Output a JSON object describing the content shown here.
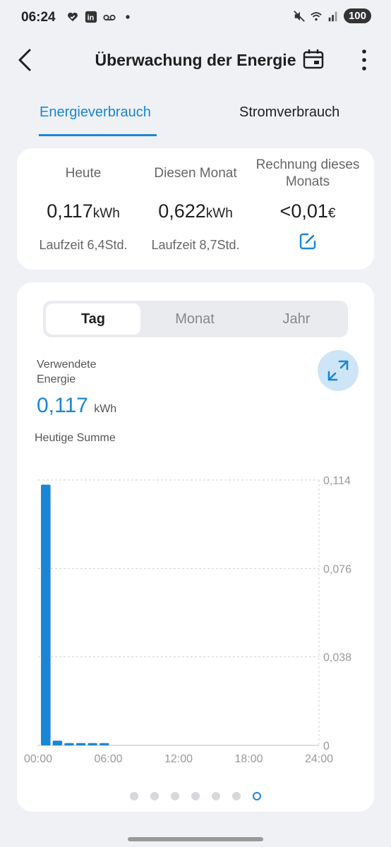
{
  "status_bar": {
    "time": "06:24",
    "battery": "100",
    "icons_left": [
      "heart-icon",
      "linkedin-icon",
      "voicemail-icon",
      "dot-icon"
    ],
    "icons_right": [
      "mute-icon",
      "wifi-icon",
      "signal-icon"
    ]
  },
  "header": {
    "title": "Überwachung der Energie",
    "icons": [
      "back-arrow-icon",
      "calendar-icon",
      "more-vert-icon"
    ]
  },
  "tabs": [
    {
      "label": "Energieverbrauch",
      "active": true
    },
    {
      "label": "Stromverbrauch",
      "active": false
    }
  ],
  "summary": {
    "today": {
      "label": "Heute",
      "value": "0,117",
      "unit": "kWh",
      "sub": "Laufzeit 6,4Std."
    },
    "month": {
      "label": "Diesen Monat",
      "value": "0,622",
      "unit": "kWh",
      "sub": "Laufzeit 8,7Std."
    },
    "bill": {
      "label_line1": "Rechnung dieses",
      "label_line2": "Monats",
      "value": "<0,01",
      "unit": "€",
      "edit_icon": "edit-icon"
    }
  },
  "period_selector": [
    {
      "label": "Tag",
      "active": true
    },
    {
      "label": "Monat",
      "active": false
    },
    {
      "label": "Jahr",
      "active": false
    }
  ],
  "energy": {
    "label_line1": "Verwendete",
    "label_line2": "Energie",
    "value": "0,117",
    "unit": "kWh",
    "sub": "Heutige Summe",
    "expand_icon": "expand-icon"
  },
  "chart_data": {
    "type": "bar",
    "x_tick_labels": [
      "00:00",
      "06:00",
      "12:00",
      "18:00",
      "24:00"
    ],
    "y_tick_labels": [
      "0,114",
      "0,076",
      "0,038",
      "0"
    ],
    "ylim": [
      0,
      0.114
    ],
    "xlim": [
      0,
      24
    ],
    "x": [
      0,
      1,
      2,
      3,
      4,
      5
    ],
    "values": [
      0.112,
      0.002,
      0.001,
      0.001,
      0.001,
      0.001
    ],
    "grid": true,
    "color": "#1a86d6"
  },
  "pager": {
    "count": 7,
    "active_index": 6
  },
  "colors": {
    "accent": "#1a86d6",
    "background": "#eff1f5",
    "card": "#ffffff"
  }
}
